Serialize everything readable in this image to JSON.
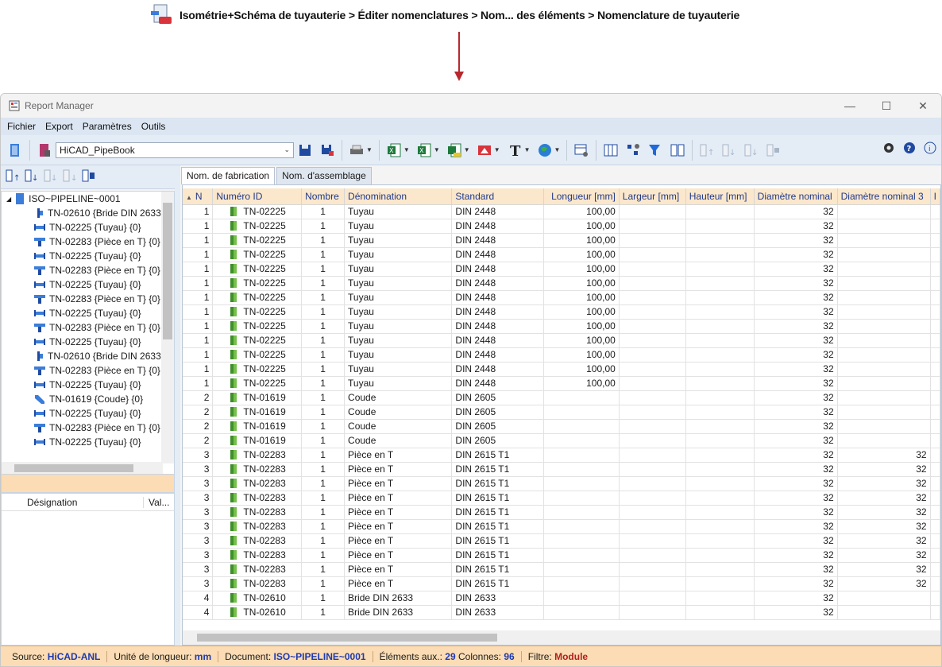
{
  "breadcrumb": {
    "text": "Isométrie+Schéma de tuyauterie > Éditer nomenclatures > Nom... des éléments > Nomenclature de tuyauterie"
  },
  "window": {
    "title": "Report Manager",
    "controls": {
      "minimize": "—",
      "maximize": "☐",
      "close": "✕"
    }
  },
  "menu": [
    "Fichier",
    "Export",
    "Paramètres",
    "Outils"
  ],
  "toolbar": {
    "combo_value": "HiCAD_PipeBook"
  },
  "tree": {
    "root": "ISO~PIPELINE~0001",
    "items": [
      {
        "label": "TN-02610 {Bride DIN 2633",
        "icon": "flange-icon"
      },
      {
        "label": "TN-02225 {Tuyau} {0}",
        "icon": "pipe-icon"
      },
      {
        "label": "TN-02283 {Pièce en T} {0}",
        "icon": "tee-icon"
      },
      {
        "label": "TN-02225 {Tuyau} {0}",
        "icon": "pipe-icon"
      },
      {
        "label": "TN-02283 {Pièce en T} {0}",
        "icon": "tee-icon"
      },
      {
        "label": "TN-02225 {Tuyau} {0}",
        "icon": "pipe-icon"
      },
      {
        "label": "TN-02283 {Pièce en T} {0}",
        "icon": "tee-icon"
      },
      {
        "label": "TN-02225 {Tuyau} {0}",
        "icon": "pipe-icon"
      },
      {
        "label": "TN-02283 {Pièce en T} {0}",
        "icon": "tee-icon"
      },
      {
        "label": "TN-02225 {Tuyau} {0}",
        "icon": "pipe-icon"
      },
      {
        "label": "TN-02610 {Bride DIN 2633",
        "icon": "flange-icon"
      },
      {
        "label": "TN-02283 {Pièce en T} {0}",
        "icon": "tee-icon"
      },
      {
        "label": "TN-02225 {Tuyau} {0}",
        "icon": "pipe-icon"
      },
      {
        "label": "TN-01619 {Coude} {0}",
        "icon": "elbow-icon"
      },
      {
        "label": "TN-02225 {Tuyau} {0}",
        "icon": "pipe-icon"
      },
      {
        "label": "TN-02283 {Pièce en T} {0}",
        "icon": "tee-icon"
      },
      {
        "label": "TN-02225 {Tuyau} {0}",
        "icon": "pipe-icon"
      }
    ]
  },
  "props": {
    "col_designation": "Désignation",
    "col_value": "Val..."
  },
  "tabs": [
    "Nom. de fabrication",
    "Nom. d'assemblage"
  ],
  "grid": {
    "columns": {
      "n": "N",
      "id": "Numéro ID",
      "nombre": "Nombre",
      "denom": "Dénomination",
      "standard": "Standard",
      "longueur": "Longueur [mm]",
      "largeur": "Largeur [mm]",
      "hauteur": "Hauteur [mm]",
      "dn": "Diamètre nominal",
      "dn3": "Diamètre nominal 3",
      "extra": "I"
    },
    "rows": [
      [
        "1",
        "TN-02225",
        "1",
        "Tuyau",
        "DIN 2448",
        "100,00",
        "",
        "",
        "32",
        ""
      ],
      [
        "1",
        "TN-02225",
        "1",
        "Tuyau",
        "DIN 2448",
        "100,00",
        "",
        "",
        "32",
        ""
      ],
      [
        "1",
        "TN-02225",
        "1",
        "Tuyau",
        "DIN 2448",
        "100,00",
        "",
        "",
        "32",
        ""
      ],
      [
        "1",
        "TN-02225",
        "1",
        "Tuyau",
        "DIN 2448",
        "100,00",
        "",
        "",
        "32",
        ""
      ],
      [
        "1",
        "TN-02225",
        "1",
        "Tuyau",
        "DIN 2448",
        "100,00",
        "",
        "",
        "32",
        ""
      ],
      [
        "1",
        "TN-02225",
        "1",
        "Tuyau",
        "DIN 2448",
        "100,00",
        "",
        "",
        "32",
        ""
      ],
      [
        "1",
        "TN-02225",
        "1",
        "Tuyau",
        "DIN 2448",
        "100,00",
        "",
        "",
        "32",
        ""
      ],
      [
        "1",
        "TN-02225",
        "1",
        "Tuyau",
        "DIN 2448",
        "100,00",
        "",
        "",
        "32",
        ""
      ],
      [
        "1",
        "TN-02225",
        "1",
        "Tuyau",
        "DIN 2448",
        "100,00",
        "",
        "",
        "32",
        ""
      ],
      [
        "1",
        "TN-02225",
        "1",
        "Tuyau",
        "DIN 2448",
        "100,00",
        "",
        "",
        "32",
        ""
      ],
      [
        "1",
        "TN-02225",
        "1",
        "Tuyau",
        "DIN 2448",
        "100,00",
        "",
        "",
        "32",
        ""
      ],
      [
        "1",
        "TN-02225",
        "1",
        "Tuyau",
        "DIN 2448",
        "100,00",
        "",
        "",
        "32",
        ""
      ],
      [
        "1",
        "TN-02225",
        "1",
        "Tuyau",
        "DIN 2448",
        "100,00",
        "",
        "",
        "32",
        ""
      ],
      [
        "2",
        "TN-01619",
        "1",
        "Coude",
        "DIN 2605",
        "",
        "",
        "",
        "32",
        ""
      ],
      [
        "2",
        "TN-01619",
        "1",
        "Coude",
        "DIN 2605",
        "",
        "",
        "",
        "32",
        ""
      ],
      [
        "2",
        "TN-01619",
        "1",
        "Coude",
        "DIN 2605",
        "",
        "",
        "",
        "32",
        ""
      ],
      [
        "2",
        "TN-01619",
        "1",
        "Coude",
        "DIN 2605",
        "",
        "",
        "",
        "32",
        ""
      ],
      [
        "3",
        "TN-02283",
        "1",
        "Pièce en T",
        "DIN 2615 T1",
        "",
        "",
        "",
        "32",
        "32"
      ],
      [
        "3",
        "TN-02283",
        "1",
        "Pièce en T",
        "DIN 2615 T1",
        "",
        "",
        "",
        "32",
        "32"
      ],
      [
        "3",
        "TN-02283",
        "1",
        "Pièce en T",
        "DIN 2615 T1",
        "",
        "",
        "",
        "32",
        "32"
      ],
      [
        "3",
        "TN-02283",
        "1",
        "Pièce en T",
        "DIN 2615 T1",
        "",
        "",
        "",
        "32",
        "32"
      ],
      [
        "3",
        "TN-02283",
        "1",
        "Pièce en T",
        "DIN 2615 T1",
        "",
        "",
        "",
        "32",
        "32"
      ],
      [
        "3",
        "TN-02283",
        "1",
        "Pièce en T",
        "DIN 2615 T1",
        "",
        "",
        "",
        "32",
        "32"
      ],
      [
        "3",
        "TN-02283",
        "1",
        "Pièce en T",
        "DIN 2615 T1",
        "",
        "",
        "",
        "32",
        "32"
      ],
      [
        "3",
        "TN-02283",
        "1",
        "Pièce en T",
        "DIN 2615 T1",
        "",
        "",
        "",
        "32",
        "32"
      ],
      [
        "3",
        "TN-02283",
        "1",
        "Pièce en T",
        "DIN 2615 T1",
        "",
        "",
        "",
        "32",
        "32"
      ],
      [
        "3",
        "TN-02283",
        "1",
        "Pièce en T",
        "DIN 2615 T1",
        "",
        "",
        "",
        "32",
        "32"
      ],
      [
        "4",
        "TN-02610",
        "1",
        "Bride DIN 2633",
        "DIN 2633",
        "",
        "",
        "",
        "32",
        ""
      ],
      [
        "4",
        "TN-02610",
        "1",
        "Bride DIN 2633",
        "DIN 2633",
        "",
        "",
        "",
        "32",
        ""
      ]
    ]
  },
  "status": {
    "source_label": "Source:",
    "source_value": "HiCAD-ANL",
    "unit_label": "Unité de longueur:",
    "unit_value": "mm",
    "doc_label": "Document:",
    "doc_value": "ISO~PIPELINE~0001",
    "aux_label": "Éléments aux.:",
    "aux_value": "29",
    "cols_label": "Colonnes:",
    "cols_value": "96",
    "filter_label": "Filtre:",
    "filter_value": "Module"
  }
}
